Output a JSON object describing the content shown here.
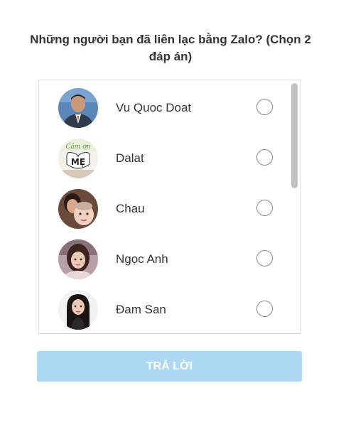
{
  "question": "Những người bạn đã liên lạc bằng Zalo? (Chọn 2 đáp án)",
  "contacts": [
    {
      "name": "Vu Quoc Doat",
      "avatar": "man-in-suit-photo",
      "selected": false
    },
    {
      "name": "Dalat",
      "avatar": "cam-on-me-heart-photo",
      "selected": false
    },
    {
      "name": "Chau",
      "avatar": "mother-and-baby-photo",
      "selected": false
    },
    {
      "name": "Ngọc Anh",
      "avatar": "young-woman-photo",
      "selected": false
    },
    {
      "name": "Đam San",
      "avatar": "woman-long-hair-photo",
      "selected": false
    }
  ],
  "avatar_text": {
    "dalat": "Cảm ơn MẸ"
  },
  "submit_label": "TRẢ LỜI",
  "colors": {
    "submit_bg": "#acd8f4",
    "border": "#dcdcdc",
    "radio_border": "#8a8a8a"
  }
}
